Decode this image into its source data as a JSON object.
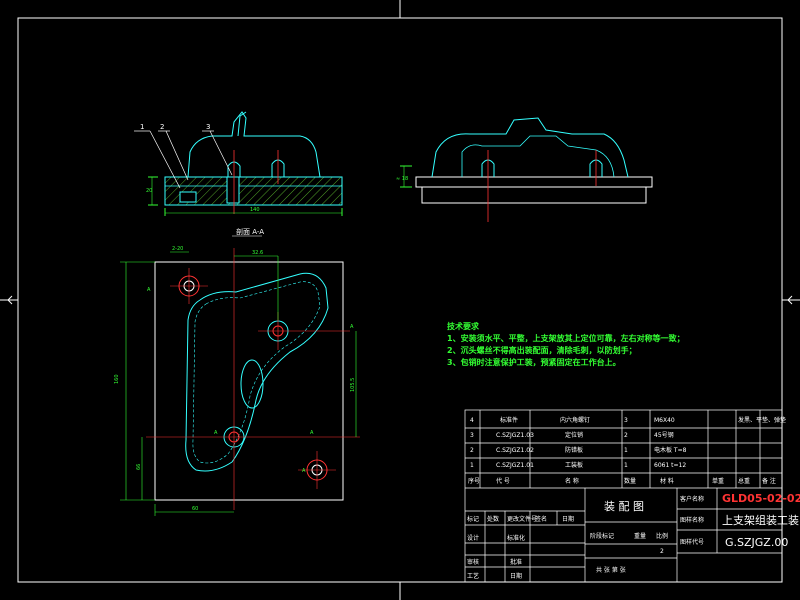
{
  "colors": {
    "background": "#000000",
    "frame": "#ffffff",
    "outline": "#33ffff",
    "dimension": "#33ff33",
    "centerline": "#ff3333",
    "hatch": "#66cc33"
  },
  "callouts": [
    "1",
    "2",
    "3"
  ],
  "section_label": "剖面 A-A",
  "dims": {
    "base_width": "140",
    "base_height": "20",
    "side_height": "≈ 18",
    "top_offset": "2-20",
    "hole_span": "32.6",
    "vert_total": "160",
    "vert_right": "105.5",
    "vert_left": "66",
    "bottom_w": "60",
    "section_mark_a": "A"
  },
  "tech_notes": {
    "title": "技术要求",
    "items": [
      "1、安装须水平、平整，上支架放其上定位可靠，左右对称等一致；",
      "2、沉头螺丝不得高出装配面，清除毛刺，以防划手；",
      "3、包销时注意保护工装，预紧固定在工作台上。"
    ]
  },
  "bom": [
    {
      "no": "4",
      "code": "标准件",
      "name": "内六角螺钉",
      "qty": "3",
      "material": "M6X40",
      "note": "发黑、平垫、弹垫"
    },
    {
      "no": "3",
      "code": "C.SZJGZ1.03",
      "name": "定位销",
      "qty": "2",
      "material": "45号钢",
      "note": ""
    },
    {
      "no": "2",
      "code": "C.SZJGZ1.02",
      "name": "防错板",
      "qty": "1",
      "material": "电木板 T=8",
      "note": ""
    },
    {
      "no": "1",
      "code": "C.SZJGZ1.01",
      "name": "工装板",
      "qty": "1",
      "material": "6061 t=12",
      "note": ""
    }
  ],
  "bom_header": [
    "序号",
    "代  号",
    "名  称",
    "数量",
    "材  料",
    "单重",
    "总重",
    "备  注"
  ],
  "title_block": {
    "drawing_type": "装 配 图",
    "customer_label": "客户名称",
    "customer_value": "GLD05-02-02",
    "drawing_name_label": "图样名称",
    "drawing_name_value": "上支架组装工装",
    "drawing_code_label": "图样代号",
    "drawing_code_value": "G.SZJGZ.00",
    "rev_headers": [
      "标记",
      "处数",
      "更改文件号",
      "签名",
      "日期"
    ],
    "sign_rows": [
      [
        "设计",
        "标准化"
      ],
      [
        "审核",
        "批准"
      ],
      [
        "工艺",
        "日期"
      ]
    ],
    "stage_headers": [
      "阶段标记",
      "重量",
      "比例"
    ],
    "scale": "2",
    "sheet": "共  张  第  张"
  }
}
